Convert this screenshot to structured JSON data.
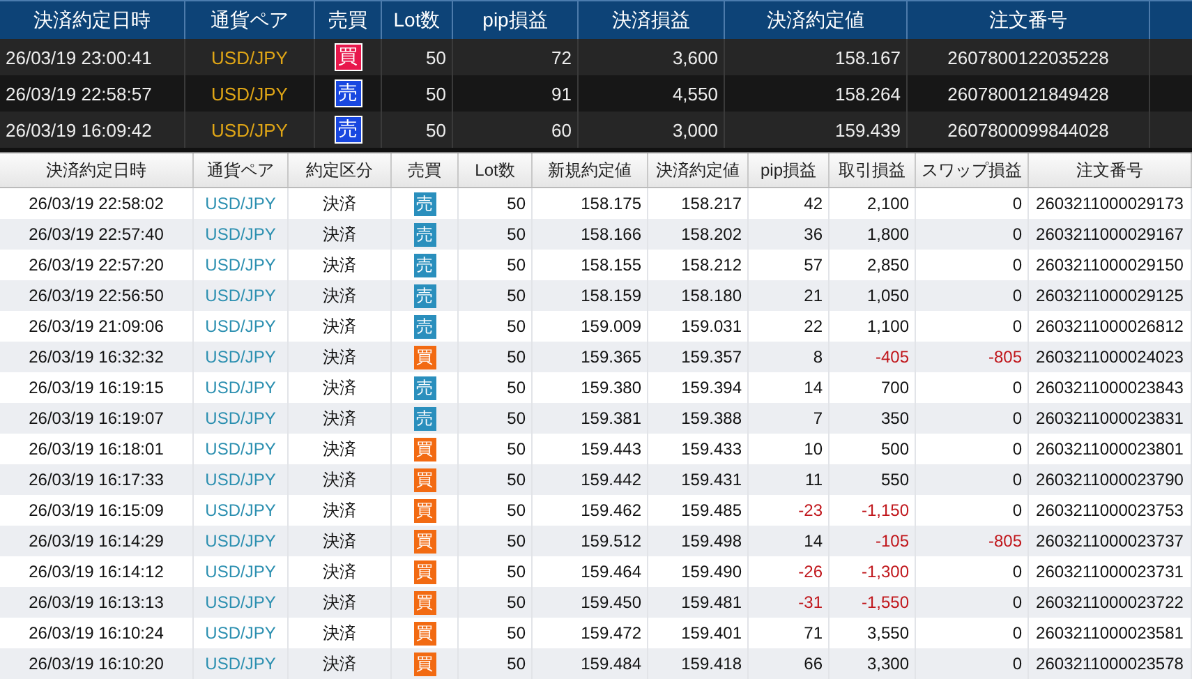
{
  "positions": {
    "columns": [
      "決済約定日時",
      "通貨ペア",
      "売買",
      "Lot数",
      "pip損益",
      "決済損益",
      "決済約定値",
      "注文番号"
    ],
    "rows": [
      {
        "datetime": "26/03/19 23:00:41",
        "pair": "USD/JPY",
        "side": "買",
        "kind": "buy",
        "lots": "50",
        "pips": "72",
        "profit": "3,600",
        "price": "158.167",
        "order_no": "2607800122035228"
      },
      {
        "datetime": "26/03/19 22:58:57",
        "pair": "USD/JPY",
        "side": "売",
        "kind": "sell",
        "lots": "50",
        "pips": "91",
        "profit": "4,550",
        "price": "158.264",
        "order_no": "2607800121849428"
      },
      {
        "datetime": "26/03/19 16:09:42",
        "pair": "USD/JPY",
        "side": "売",
        "kind": "sell",
        "lots": "50",
        "pips": "60",
        "profit": "3,000",
        "price": "159.439",
        "order_no": "2607800099844028"
      }
    ]
  },
  "history": {
    "columns": [
      "決済約定日時",
      "通貨ペア",
      "約定区分",
      "売買",
      "Lot数",
      "新規約定値",
      "決済約定値",
      "pip損益",
      "取引損益",
      "スワップ損益",
      "注文番号"
    ],
    "rows": [
      {
        "datetime": "26/03/19 22:58:02",
        "pair": "USD/JPY",
        "type": "決済",
        "side": "売",
        "kind": "sell",
        "lots": "50",
        "open_price": "158.175",
        "close_price": "158.217",
        "pips": "42",
        "pips_red": false,
        "trade_pl": "2,100",
        "trade_pl_red": false,
        "swap_pl": "0",
        "swap_pl_red": false,
        "order_no": "2603211000029173"
      },
      {
        "datetime": "26/03/19 22:57:40",
        "pair": "USD/JPY",
        "type": "決済",
        "side": "売",
        "kind": "sell",
        "lots": "50",
        "open_price": "158.166",
        "close_price": "158.202",
        "pips": "36",
        "pips_red": false,
        "trade_pl": "1,800",
        "trade_pl_red": false,
        "swap_pl": "0",
        "swap_pl_red": false,
        "order_no": "2603211000029167"
      },
      {
        "datetime": "26/03/19 22:57:20",
        "pair": "USD/JPY",
        "type": "決済",
        "side": "売",
        "kind": "sell",
        "lots": "50",
        "open_price": "158.155",
        "close_price": "158.212",
        "pips": "57",
        "pips_red": false,
        "trade_pl": "2,850",
        "trade_pl_red": false,
        "swap_pl": "0",
        "swap_pl_red": false,
        "order_no": "2603211000029150"
      },
      {
        "datetime": "26/03/19 22:56:50",
        "pair": "USD/JPY",
        "type": "決済",
        "side": "売",
        "kind": "sell",
        "lots": "50",
        "open_price": "158.159",
        "close_price": "158.180",
        "pips": "21",
        "pips_red": false,
        "trade_pl": "1,050",
        "trade_pl_red": false,
        "swap_pl": "0",
        "swap_pl_red": false,
        "order_no": "2603211000029125"
      },
      {
        "datetime": "26/03/19 21:09:06",
        "pair": "USD/JPY",
        "type": "決済",
        "side": "売",
        "kind": "sell",
        "lots": "50",
        "open_price": "159.009",
        "close_price": "159.031",
        "pips": "22",
        "pips_red": false,
        "trade_pl": "1,100",
        "trade_pl_red": false,
        "swap_pl": "0",
        "swap_pl_red": false,
        "order_no": "2603211000026812"
      },
      {
        "datetime": "26/03/19 16:32:32",
        "pair": "USD/JPY",
        "type": "決済",
        "side": "買",
        "kind": "buy",
        "lots": "50",
        "open_price": "159.365",
        "close_price": "159.357",
        "pips": "8",
        "pips_red": false,
        "trade_pl": "-405",
        "trade_pl_red": true,
        "swap_pl": "-805",
        "swap_pl_red": true,
        "order_no": "2603211000024023"
      },
      {
        "datetime": "26/03/19 16:19:15",
        "pair": "USD/JPY",
        "type": "決済",
        "side": "売",
        "kind": "sell",
        "lots": "50",
        "open_price": "159.380",
        "close_price": "159.394",
        "pips": "14",
        "pips_red": false,
        "trade_pl": "700",
        "trade_pl_red": false,
        "swap_pl": "0",
        "swap_pl_red": false,
        "order_no": "2603211000023843"
      },
      {
        "datetime": "26/03/19 16:19:07",
        "pair": "USD/JPY",
        "type": "決済",
        "side": "売",
        "kind": "sell",
        "lots": "50",
        "open_price": "159.381",
        "close_price": "159.388",
        "pips": "7",
        "pips_red": false,
        "trade_pl": "350",
        "trade_pl_red": false,
        "swap_pl": "0",
        "swap_pl_red": false,
        "order_no": "2603211000023831"
      },
      {
        "datetime": "26/03/19 16:18:01",
        "pair": "USD/JPY",
        "type": "決済",
        "side": "買",
        "kind": "buy",
        "lots": "50",
        "open_price": "159.443",
        "close_price": "159.433",
        "pips": "10",
        "pips_red": false,
        "trade_pl": "500",
        "trade_pl_red": false,
        "swap_pl": "0",
        "swap_pl_red": false,
        "order_no": "2603211000023801"
      },
      {
        "datetime": "26/03/19 16:17:33",
        "pair": "USD/JPY",
        "type": "決済",
        "side": "買",
        "kind": "buy",
        "lots": "50",
        "open_price": "159.442",
        "close_price": "159.431",
        "pips": "11",
        "pips_red": false,
        "trade_pl": "550",
        "trade_pl_red": false,
        "swap_pl": "0",
        "swap_pl_red": false,
        "order_no": "2603211000023790"
      },
      {
        "datetime": "26/03/19 16:15:09",
        "pair": "USD/JPY",
        "type": "決済",
        "side": "買",
        "kind": "buy",
        "lots": "50",
        "open_price": "159.462",
        "close_price": "159.485",
        "pips": "-23",
        "pips_red": true,
        "trade_pl": "-1,150",
        "trade_pl_red": true,
        "swap_pl": "0",
        "swap_pl_red": false,
        "order_no": "2603211000023753"
      },
      {
        "datetime": "26/03/19 16:14:29",
        "pair": "USD/JPY",
        "type": "決済",
        "side": "買",
        "kind": "buy",
        "lots": "50",
        "open_price": "159.512",
        "close_price": "159.498",
        "pips": "14",
        "pips_red": false,
        "trade_pl": "-105",
        "trade_pl_red": true,
        "swap_pl": "-805",
        "swap_pl_red": true,
        "order_no": "2603211000023737"
      },
      {
        "datetime": "26/03/19 16:14:12",
        "pair": "USD/JPY",
        "type": "決済",
        "side": "買",
        "kind": "buy",
        "lots": "50",
        "open_price": "159.464",
        "close_price": "159.490",
        "pips": "-26",
        "pips_red": true,
        "trade_pl": "-1,300",
        "trade_pl_red": true,
        "swap_pl": "0",
        "swap_pl_red": false,
        "order_no": "2603211000023731"
      },
      {
        "datetime": "26/03/19 16:13:13",
        "pair": "USD/JPY",
        "type": "決済",
        "side": "買",
        "kind": "buy",
        "lots": "50",
        "open_price": "159.450",
        "close_price": "159.481",
        "pips": "-31",
        "pips_red": true,
        "trade_pl": "-1,550",
        "trade_pl_red": true,
        "swap_pl": "0",
        "swap_pl_red": false,
        "order_no": "2603211000023722"
      },
      {
        "datetime": "26/03/19 16:10:24",
        "pair": "USD/JPY",
        "type": "決済",
        "side": "買",
        "kind": "buy",
        "lots": "50",
        "open_price": "159.472",
        "close_price": "159.401",
        "pips": "71",
        "pips_red": false,
        "trade_pl": "3,550",
        "trade_pl_red": false,
        "swap_pl": "0",
        "swap_pl_red": false,
        "order_no": "2603211000023581"
      },
      {
        "datetime": "26/03/19 16:10:20",
        "pair": "USD/JPY",
        "type": "決済",
        "side": "買",
        "kind": "buy",
        "lots": "50",
        "open_price": "159.484",
        "close_price": "159.418",
        "pips": "66",
        "pips_red": false,
        "trade_pl": "3,300",
        "trade_pl_red": false,
        "swap_pl": "0",
        "swap_pl_red": false,
        "order_no": "2603211000023578"
      }
    ]
  }
}
